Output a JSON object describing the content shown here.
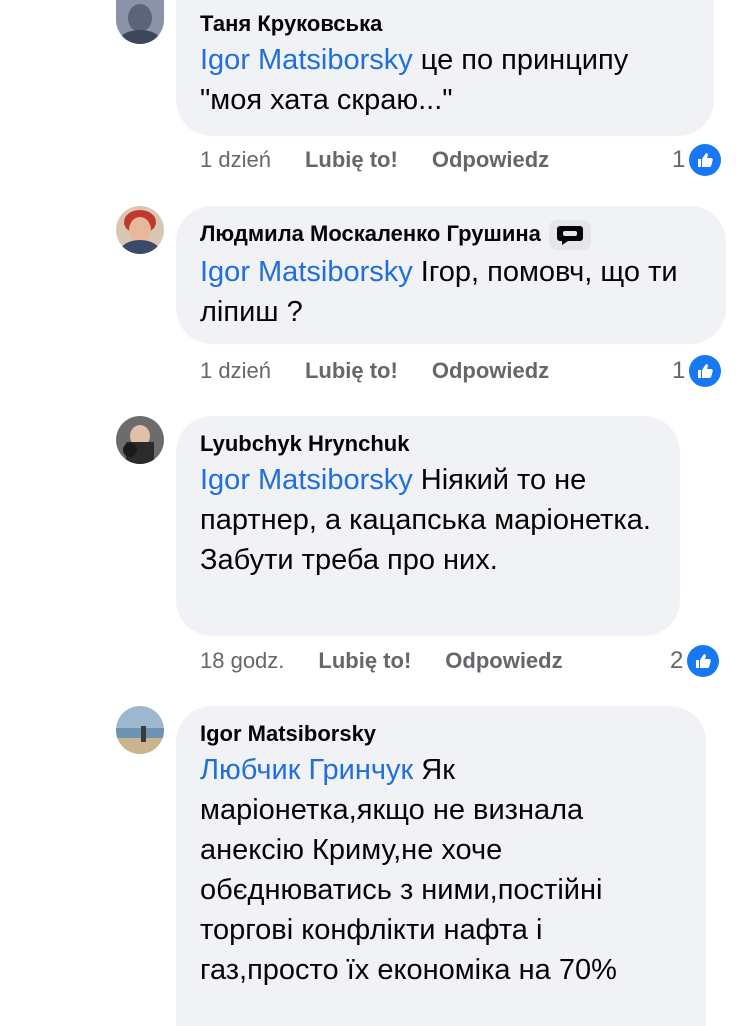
{
  "comments": [
    {
      "author": "Таня Круковська",
      "mention": "Igor Matsiborsky",
      "text": " це по принципу \"моя хата скраю...\"",
      "time": "1 dzień",
      "like_label": "Lubię to!",
      "reply_label": "Odpowiedz",
      "reaction_count": "1"
    },
    {
      "author": "Людмила Москаленко Грушина",
      "mention": "Igor Matsiborsky",
      "text": " Ігор, помовч, що ти ліпиш ?",
      "time": "1 dzień",
      "like_label": "Lubię to!",
      "reply_label": "Odpowiedz",
      "reaction_count": "1"
    },
    {
      "author": "Lyubchyk Hrynchuk",
      "mention": "Igor Matsiborsky",
      "text": " Ніякий то не партнер, а кацапська маріонетка. Забути треба про них.",
      "time": "18 godz.",
      "like_label": "Lubię to!",
      "reply_label": "Odpowiedz",
      "reaction_count": "2"
    },
    {
      "author": "Igor Matsiborsky",
      "mention": "Любчик Гринчук",
      "text": " Як маріонетка,якщо не визнала анексію Криму,не хоче обєднюватись з ними,постійні торгові конфлікти нафта і газ,просто їх економіка на 70%"
    }
  ],
  "colors": {
    "bubble": "#f0f2f5",
    "mention": "#216fdb",
    "meta": "#65676b",
    "like": "#1877f2"
  }
}
